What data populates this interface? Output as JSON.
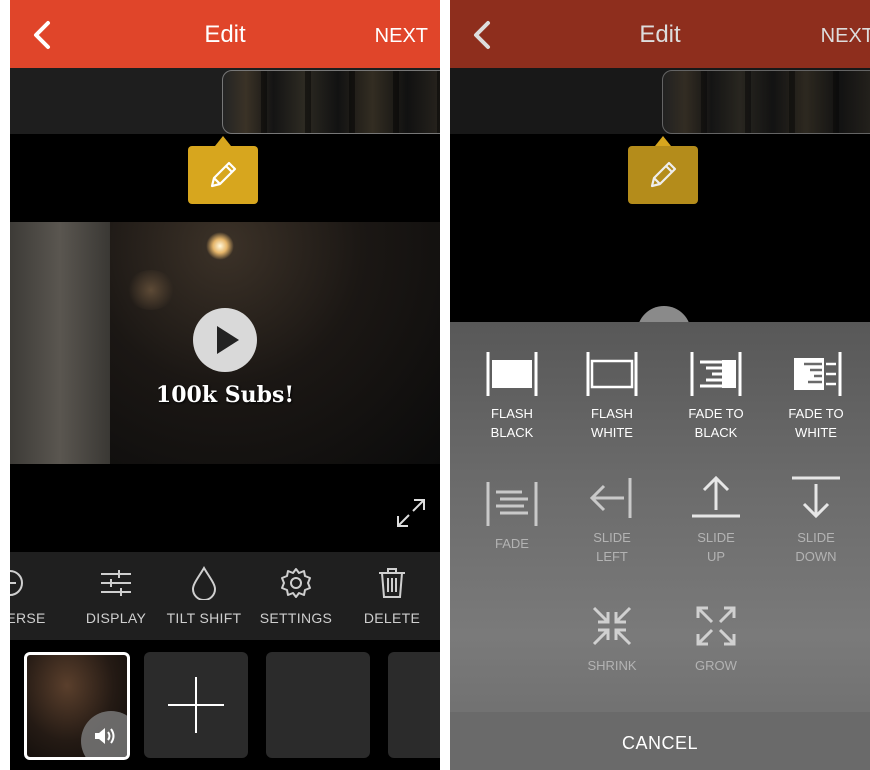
{
  "colors": {
    "header": "#e0452a",
    "header_dimmed": "#8e2e1d",
    "edit_tag": "#d7a61e"
  },
  "left": {
    "header": {
      "title": "Edit",
      "next": "NEXT",
      "back_icon": "chevron-left-icon"
    },
    "preview": {
      "caption": "100k Subs!",
      "play_icon": "play-icon",
      "expand_icon": "expand-icon"
    },
    "toolbar": [
      {
        "label": "ERSE",
        "icon": "reverse-icon"
      },
      {
        "label": "DISPLAY",
        "icon": "sliders-icon"
      },
      {
        "label": "TILT SHIFT",
        "icon": "droplet-icon"
      },
      {
        "label": "SETTINGS",
        "icon": "gear-icon"
      },
      {
        "label": "DELETE",
        "icon": "trash-icon"
      }
    ],
    "strip": {
      "volume_icon": "speaker-icon",
      "add_icon": "plus-icon"
    }
  },
  "right": {
    "header": {
      "title": "Edit",
      "next": "NEXT"
    },
    "transitions": {
      "row1": [
        {
          "l1": "FLASH",
          "l2": "BLACK"
        },
        {
          "l1": "FLASH",
          "l2": "WHITE"
        },
        {
          "l1": "FADE TO",
          "l2": "BLACK"
        },
        {
          "l1": "FADE TO",
          "l2": "WHITE"
        }
      ],
      "row2": [
        {
          "l1": "FADE",
          "l2": ""
        },
        {
          "l1": "SLIDE",
          "l2": "LEFT"
        },
        {
          "l1": "SLIDE",
          "l2": "UP"
        },
        {
          "l1": "SLIDE",
          "l2": "DOWN"
        }
      ],
      "row3": [
        {
          "l1": "SHRINK",
          "l2": ""
        },
        {
          "l1": "GROW",
          "l2": ""
        }
      ]
    },
    "cancel": "CANCEL"
  }
}
